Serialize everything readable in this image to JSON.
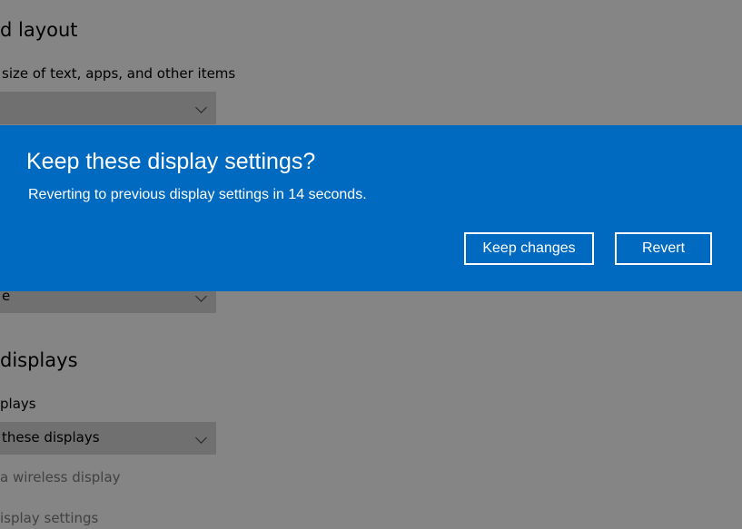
{
  "background": {
    "scale_heading": "d layout",
    "scale_label": "size of text, apps, and other items",
    "scale_dropdown_value": "",
    "orientation_dropdown_value": "e",
    "multiple_heading": "displays",
    "multiple_label": "plays",
    "multiple_dropdown_value": "these displays",
    "wireless_link": "a wireless display",
    "advanced_link": "isplay settings"
  },
  "dialog": {
    "title": "Keep these display settings?",
    "message": "Reverting to previous display settings in 14 seconds.",
    "keep_label": "Keep changes",
    "revert_label": "Revert",
    "accent_color": "#0069c0"
  }
}
